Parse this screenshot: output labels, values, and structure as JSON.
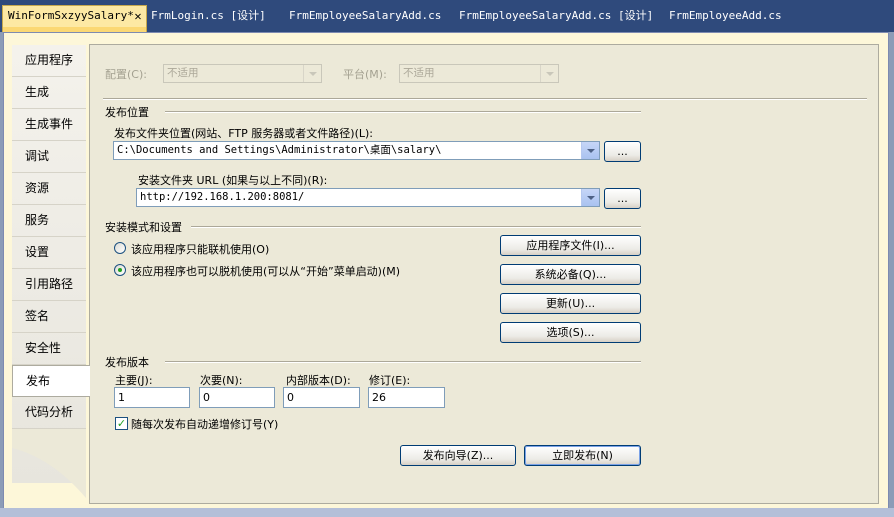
{
  "tabs": [
    {
      "label": "WinFormSxzyySalary*",
      "close": "✕"
    },
    {
      "label": "FrmLogin.cs [设计]"
    },
    {
      "label": "FrmEmployeeSalaryAdd.cs"
    },
    {
      "label": "FrmEmployeeSalaryAdd.cs [设计]"
    },
    {
      "label": "FrmEmployeeAdd.cs"
    }
  ],
  "nav": {
    "items": [
      "应用程序",
      "生成",
      "生成事件",
      "调试",
      "资源",
      "服务",
      "设置",
      "引用路径",
      "签名",
      "安全性",
      "发布",
      "代码分析"
    ],
    "active": "发布"
  },
  "config": {
    "config_label": "配置(C):",
    "config_value": "不适用",
    "platform_label": "平台(M):",
    "platform_value": "不适用"
  },
  "publish_location": {
    "section": "发布位置",
    "folder_label": "发布文件夹位置(网站、FTP 服务器或者文件路径)(L):",
    "folder_value": "C:\\Documents and Settings\\Administrator\\桌面\\salary\\",
    "install_url_label": "安装文件夹 URL (如果与以上不同)(R):",
    "install_url_value": "http://192.168.1.200:8081/",
    "browse_label": "..."
  },
  "install_mode": {
    "section": "安装模式和设置",
    "online_only": "该应用程序只能联机使用(O)",
    "offline": "该应用程序也可以脱机使用(可以从“开始”菜单启动)(M)",
    "selected": "offline",
    "buttons": [
      "应用程序文件(I)...",
      "系统必备(Q)...",
      "更新(U)...",
      "选项(S)..."
    ]
  },
  "version": {
    "section": "发布版本",
    "major_label": "主要(J):",
    "major": "1",
    "minor_label": "次要(N):",
    "minor": "0",
    "build_label": "内部版本(D):",
    "build": "0",
    "revision_label": "修订(E):",
    "revision": "26",
    "auto_increment_label": "随每次发布自动递增修订号(Y)",
    "auto_increment": true
  },
  "actions": {
    "wizard": "发布向导(Z)...",
    "publish_now": "立即发布(N)"
  },
  "colors": {
    "tab_active": "#fde9a4",
    "tabstrip": "#2f4a7c",
    "dialog": "#ece9d8"
  }
}
